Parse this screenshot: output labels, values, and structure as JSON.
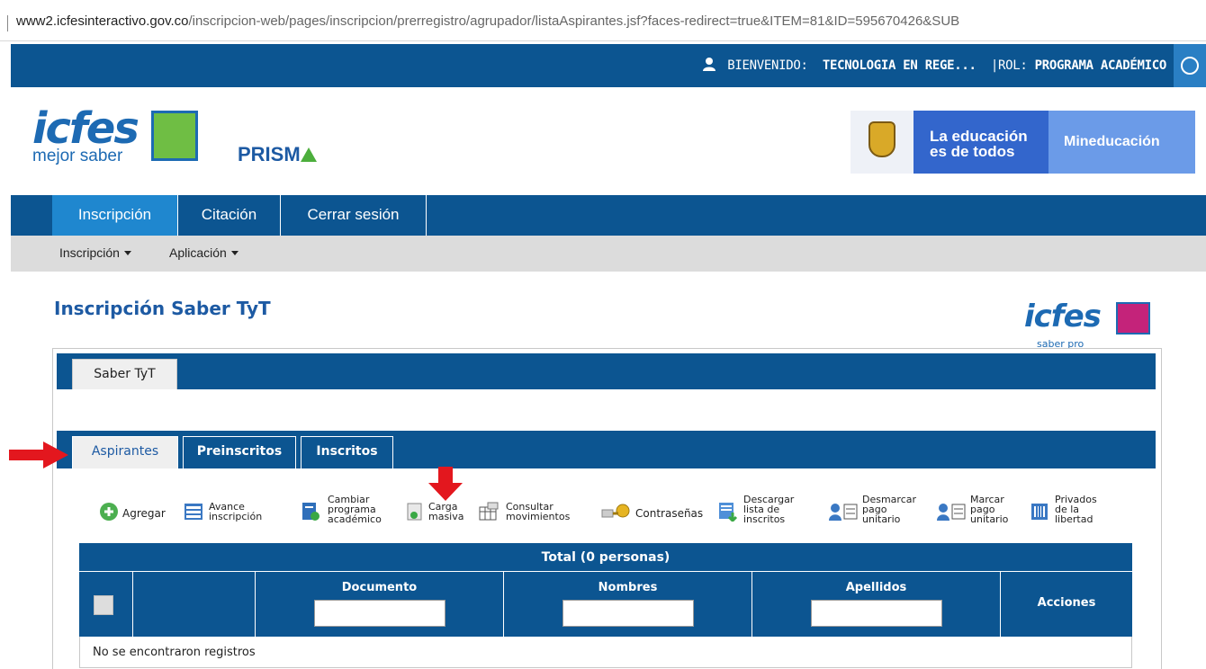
{
  "browser": {
    "url_domain": "www2.icfesinteractivo.gov.co",
    "url_path": "/inscripcion-web/pages/inscripcion/prerregistro/agrupador/listaAspirantes.jsf?faces-redirect=true&ITEM=81&ID=595670426&SUB"
  },
  "topbar": {
    "welcome_label": "BIENVENIDO:",
    "user_name": "TECNOLOGIA EN REGE...",
    "role_label": "|ROL:",
    "role_value": "PROGRAMA ACADÉMICO"
  },
  "header": {
    "logo_word": "icfes",
    "logo_sub": "mejor saber",
    "prisma_text": "PRISM",
    "gov_edu_line1": "La educación",
    "gov_edu_line2": "es de todos",
    "gov_min": "Mineducación"
  },
  "mainnav": [
    "Inscripción",
    "Citación",
    "Cerrar sesión"
  ],
  "subnav": [
    "Inscripción",
    "Aplicación"
  ],
  "page_title": "Inscripción Saber TyT",
  "saber_pro_logo": {
    "word": "icfes",
    "sub": "saber pro"
  },
  "exam_tabs": [
    "Saber TyT"
  ],
  "list_tabs": [
    "Aspirantes",
    "Preinscritos",
    "Inscritos"
  ],
  "toolbar": [
    {
      "label": "Agregar",
      "icon": "add-icon"
    },
    {
      "label": "Avance\ninscripción",
      "icon": "progress-icon"
    },
    {
      "label": "Cambiar\nprograma\nacadémico",
      "icon": "change-program-icon"
    },
    {
      "label": "Carga\nmasiva",
      "icon": "bulk-upload-icon"
    },
    {
      "label": "Consultar\nmovimientos",
      "icon": "movements-icon"
    },
    {
      "label": "Contraseñas",
      "icon": "key-icon"
    },
    {
      "label": "Descargar\nlista de\ninscritos",
      "icon": "download-list-icon"
    },
    {
      "label": "Desmarcar\npago\nunitario",
      "icon": "unmark-payment-icon"
    },
    {
      "label": "Marcar\npago\nunitario",
      "icon": "mark-payment-icon"
    },
    {
      "label": "Privados\nde la\nlibertad",
      "icon": "prisoners-icon"
    }
  ],
  "grid": {
    "total": "Total (0 personas)",
    "col_documento": "Documento",
    "col_nombres": "Nombres",
    "col_apellidos": "Apellidos",
    "col_acciones": "Acciones",
    "empty": "No se encontraron registros"
  },
  "colors": {
    "primary": "#0c5591",
    "accent": "#1f87cf",
    "annotation": "#e3171e"
  }
}
